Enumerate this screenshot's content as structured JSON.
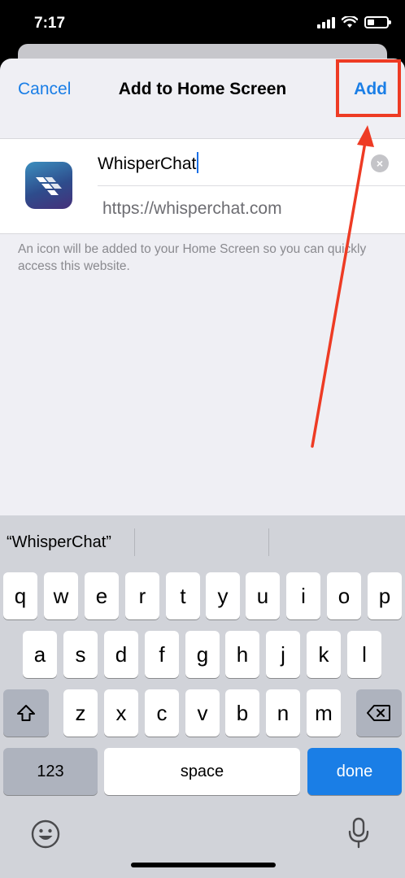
{
  "status_bar": {
    "time": "7:17"
  },
  "nav": {
    "cancel": "Cancel",
    "title": "Add to Home Screen",
    "add": "Add"
  },
  "form": {
    "name_value": "WhisperChat",
    "url": "https://whisperchat.com"
  },
  "hint": "An icon will be added to your Home Screen so you can quickly access this website.",
  "keyboard": {
    "suggestion": "“WhisperChat”",
    "row1": [
      "q",
      "w",
      "e",
      "r",
      "t",
      "y",
      "u",
      "i",
      "o",
      "p"
    ],
    "row2": [
      "a",
      "s",
      "d",
      "f",
      "g",
      "h",
      "j",
      "k",
      "l"
    ],
    "row3": [
      "z",
      "x",
      "c",
      "v",
      "b",
      "n",
      "m"
    ],
    "numbers": "123",
    "space": "space",
    "done": "done"
  },
  "colors": {
    "accent": "#1a7ee6",
    "annotation": "#ee3b24"
  }
}
